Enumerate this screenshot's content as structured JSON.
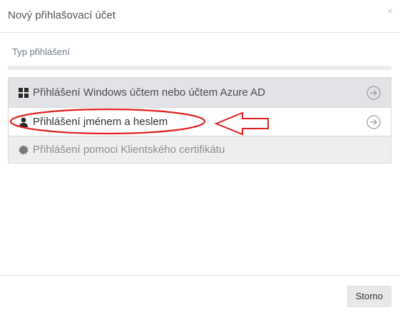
{
  "dialog": {
    "title": "Nový přihlašovací účet",
    "close_glyph": "×"
  },
  "section": {
    "label": "Typ přihlášení"
  },
  "options": [
    {
      "label": "Přihlášení Windows účtem nebo účtem Azure AD",
      "icon": "windows-icon",
      "arrow": "arrow-circle-right-icon"
    },
    {
      "label": "Přihlášení jménem a heslem",
      "icon": "user-icon",
      "arrow": "arrow-circle-right-icon"
    },
    {
      "label": "Přihlášení pomoci Klientského certifikátu",
      "icon": "certificate-icon"
    }
  ],
  "footer": {
    "cancel_label": "Storno"
  },
  "colors": {
    "annotation": "#e02020",
    "selected_bg": "#e1e3e6",
    "disabled_bg": "#eeeeee"
  }
}
